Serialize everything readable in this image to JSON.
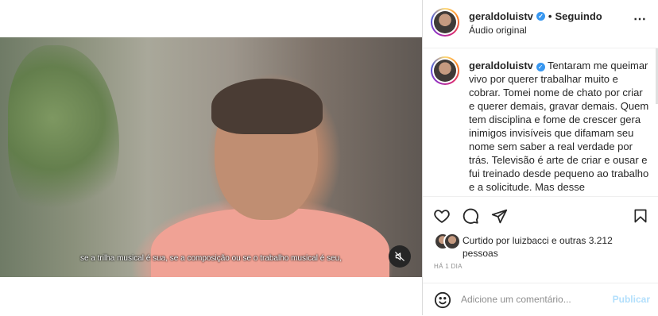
{
  "video": {
    "subtitle": "se a trilha musical é sua, se a composição ou se o trabalho musical é seu,"
  },
  "header": {
    "username": "geraldoluistv",
    "separator": "•",
    "follow_status": "Seguindo",
    "audio": "Áudio original"
  },
  "caption": {
    "username": "geraldoluistv",
    "text": "Tentaram me queimar vivo por querer trabalhar muito e cobrar. Tomei nome de chato por criar e querer demais, gravar demais. Quem tem disciplina e fome de crescer gera inimigos invisíveis que difamam seu nome sem saber a real verdade por trás. Televisão é arte de criar e ousar e fui treinado desde pequeno ao trabalho e a solicitude. Mas desse"
  },
  "likes": {
    "text": "Curtido por luizbacci e outras 3.212 pessoas"
  },
  "time_ago": "HÁ 1 DIA",
  "comment": {
    "placeholder": "Adicione um comentário...",
    "publish_label": "Publicar"
  },
  "colors": {
    "verified": "#3897f0",
    "publish_disabled": "#b2dffc",
    "muted_text": "#8e8e8e"
  }
}
